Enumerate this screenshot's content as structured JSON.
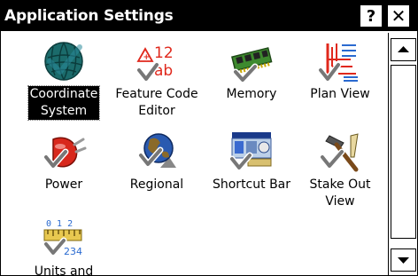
{
  "window": {
    "title": "Application Settings",
    "help_label": "?",
    "close_label": "✕"
  },
  "items": [
    {
      "label_lines": [
        "Coordinate",
        "System"
      ],
      "icon": "globe-grid-icon",
      "selected": true
    },
    {
      "label_lines": [
        "Feature Code",
        "Editor"
      ],
      "icon": "feature-code-icon",
      "selected": false
    },
    {
      "label_lines": [
        "Memory"
      ],
      "icon": "memory-chip-icon",
      "selected": false
    },
    {
      "label_lines": [
        "Plan View"
      ],
      "icon": "plan-view-icon",
      "selected": false
    },
    {
      "label_lines": [
        "Power"
      ],
      "icon": "power-plug-icon",
      "selected": false
    },
    {
      "label_lines": [
        "Regional"
      ],
      "icon": "regional-globe-icon",
      "selected": false
    },
    {
      "label_lines": [
        "Shortcut Bar"
      ],
      "icon": "shortcut-bar-icon",
      "selected": false
    },
    {
      "label_lines": [
        "Stake Out",
        "View"
      ],
      "icon": "stake-out-hammer-icon",
      "selected": false
    },
    {
      "label_lines": [
        "Units and"
      ],
      "icon": "units-ruler-icon",
      "selected": false
    }
  ],
  "icon_text": {
    "feature_top": "12",
    "feature_bottom": "ab",
    "units_top": "0 1 2",
    "units_bottom": "234"
  },
  "colors": {
    "titlebar": "#000000",
    "selection": "#000000",
    "check_green": "#5a9e3a",
    "memory_green": "#3e8a2e",
    "power_red": "#d8281c",
    "planview_red": "#e0281c",
    "planview_blue": "#2a6ad0",
    "globe_teal": "#1e6a6a"
  }
}
